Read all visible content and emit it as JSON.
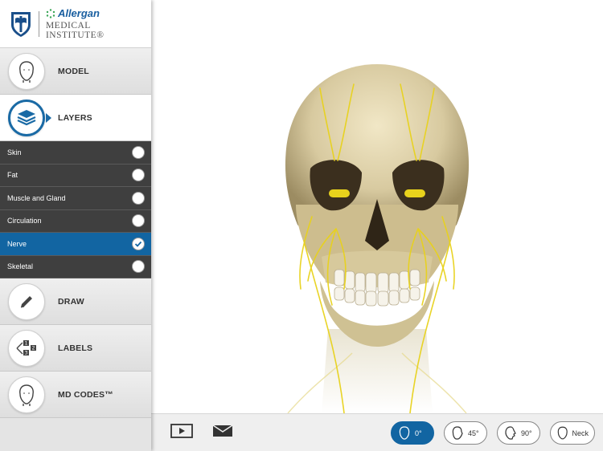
{
  "brand": {
    "name": "Allergan",
    "subtitle": "MEDICAL INSTITUTE®"
  },
  "nav": {
    "model": "MODEL",
    "layers": "LAYERS",
    "draw": "DRAW",
    "labels": "LABELS",
    "md_codes": "MD CODES™"
  },
  "layers": [
    {
      "label": "Skin",
      "checked": false
    },
    {
      "label": "Fat",
      "checked": false
    },
    {
      "label": "Muscle and Gland",
      "checked": false
    },
    {
      "label": "Circulation",
      "checked": false
    },
    {
      "label": "Nerve",
      "checked": true
    },
    {
      "label": "Skeletal",
      "checked": false
    }
  ],
  "views": {
    "v0": "0°",
    "v45": "45°",
    "v90": "90°",
    "neck": "Neck"
  },
  "icons": [
    "head-icon",
    "layers-icon",
    "pencil-icon",
    "labels-icon",
    "play-icon",
    "mail-icon",
    "checkmark-icon"
  ],
  "colors": {
    "accent": "#1265a2",
    "nerve": "#e8d21c",
    "bone": "#d8caa0"
  }
}
